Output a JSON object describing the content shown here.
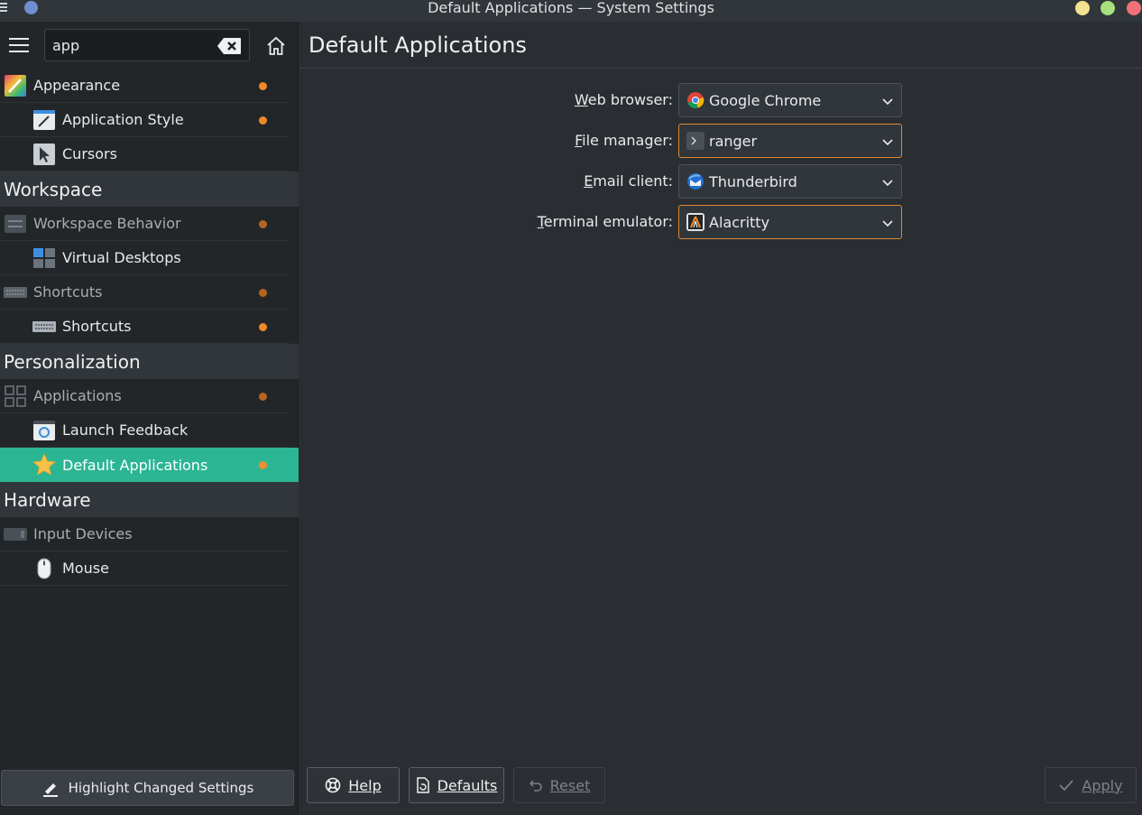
{
  "window": {
    "title": "Default Applications — System Settings"
  },
  "sidebar": {
    "search": {
      "value": "app"
    },
    "items": [
      {
        "kind": "item",
        "label": "Appearance",
        "changed": true,
        "dim": false,
        "sub": false
      },
      {
        "kind": "item",
        "label": "Application Style",
        "changed": true,
        "dim": false,
        "sub": true
      },
      {
        "kind": "item",
        "label": "Cursors",
        "changed": false,
        "dim": false,
        "sub": true
      },
      {
        "kind": "section",
        "label": "Workspace"
      },
      {
        "kind": "item",
        "label": "Workspace Behavior",
        "changed": true,
        "dim": true,
        "sub": false
      },
      {
        "kind": "item",
        "label": "Virtual Desktops",
        "changed": false,
        "dim": false,
        "sub": true
      },
      {
        "kind": "item",
        "label": "Shortcuts",
        "changed": true,
        "dim": true,
        "sub": false
      },
      {
        "kind": "item",
        "label": "Shortcuts",
        "changed": true,
        "dim": false,
        "sub": true
      },
      {
        "kind": "section",
        "label": "Personalization"
      },
      {
        "kind": "item",
        "label": "Applications",
        "changed": true,
        "dim": true,
        "sub": false
      },
      {
        "kind": "item",
        "label": "Launch Feedback",
        "changed": false,
        "dim": false,
        "sub": true
      },
      {
        "kind": "item",
        "label": "Default Applications",
        "changed": true,
        "dim": false,
        "sub": true,
        "active": true
      },
      {
        "kind": "section",
        "label": "Hardware"
      },
      {
        "kind": "item",
        "label": "Input Devices",
        "changed": false,
        "dim": true,
        "sub": false
      },
      {
        "kind": "item",
        "label": "Mouse",
        "changed": false,
        "dim": false,
        "sub": true
      }
    ],
    "highlight_button": "Highlight Changed Settings"
  },
  "main": {
    "title": "Default Applications",
    "fields": [
      {
        "mnemonic": "W",
        "rest": "eb browser:",
        "value": "Google Chrome",
        "icon": "chrome-icon",
        "focused": false
      },
      {
        "mnemonic": "F",
        "rest": "ile manager:",
        "value": "ranger",
        "icon": "terminal-icon",
        "focused": true
      },
      {
        "mnemonic": "E",
        "rest": "mail client:",
        "value": "Thunderbird",
        "icon": "thunderbird-icon",
        "focused": false
      },
      {
        "mnemonic": "T",
        "rest": "erminal emulator:",
        "value": "Alacritty",
        "icon": "alacritty-icon",
        "focused": true
      }
    ]
  },
  "footer": {
    "help": "Help",
    "defaults": "Defaults",
    "reset": "Reset",
    "apply": "Apply"
  },
  "colors": {
    "accent": "#2bb593",
    "changed_dot": "#f0892a",
    "focus_border": "#d98a34"
  }
}
